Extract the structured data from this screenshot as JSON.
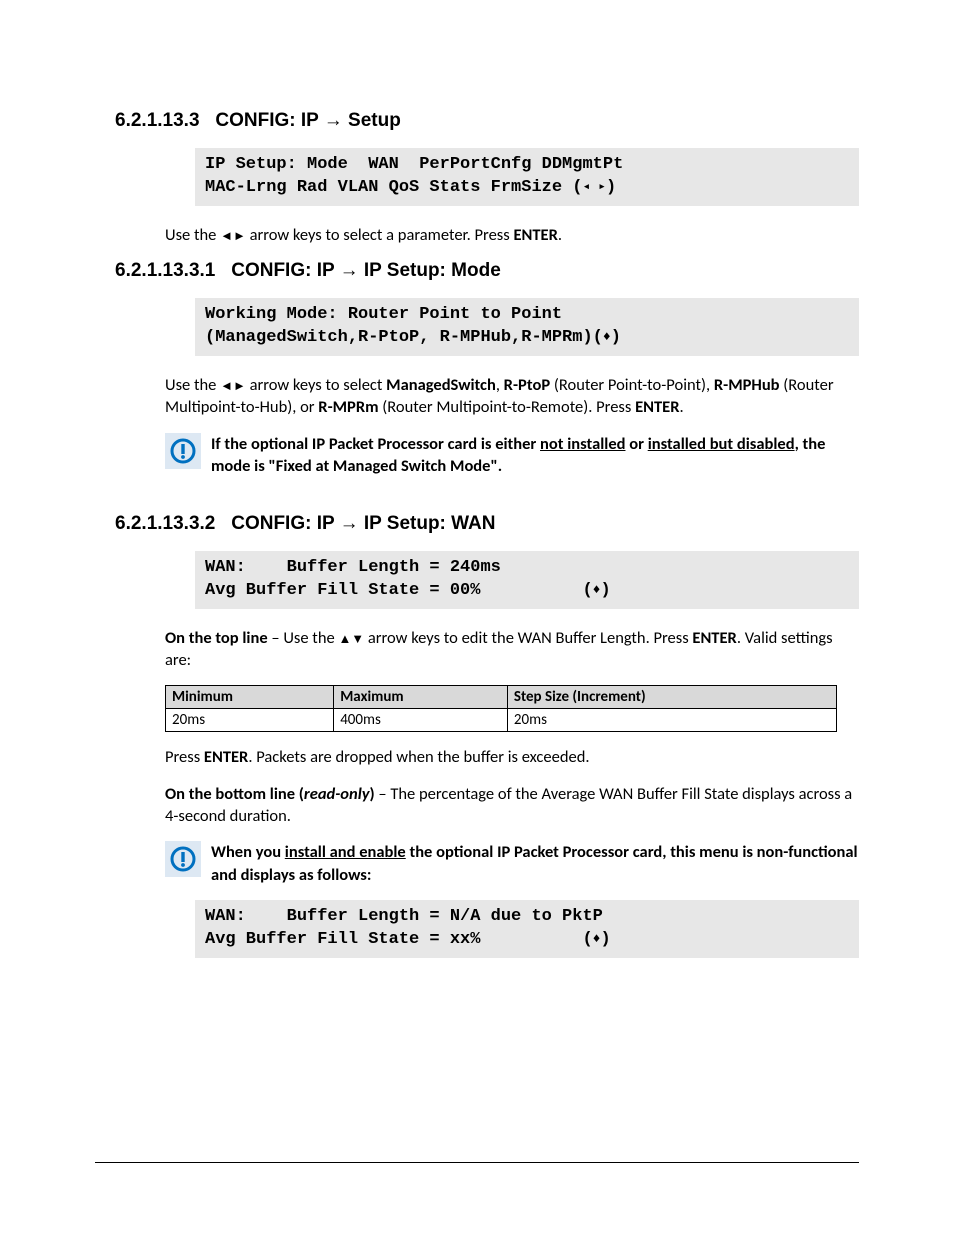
{
  "section1": {
    "heading_num": "6.2.1.13.3",
    "heading_prefix": "CONFIG: IP ",
    "heading_suffix": " Setup",
    "lcd_line1": "IP Setup: Mode  WAN  PerPortCnfg DDMgmtPt",
    "lcd_line2a": "MAC-Lrng Rad VLAN QoS Stats FrmSize (",
    "lcd_line2b": ")",
    "para_a": "Use the ",
    "para_b": " arrow keys to select a parameter. Press ",
    "para_enter": "ENTER",
    "para_c": "."
  },
  "section2": {
    "heading_num": "6.2.1.13.3.1",
    "heading_prefix": "CONFIG: IP ",
    "heading_suffix": " IP Setup: Mode",
    "lcd_line1": "Working Mode: Router Point to Point",
    "lcd_line2a": "(ManagedSwitch,R-PtoP, R-MPHub,R-MPRm)(",
    "lcd_line2b": ")",
    "para_a": "Use the ",
    "para_b": " arrow keys to select ",
    "opt1": "ManagedSwitch",
    "sep1": ", ",
    "opt2": "R-PtoP",
    "opt2_desc": " (Router Point-to-Point), ",
    "opt3": "R-MPHub",
    "opt3_desc": " (Router Multipoint-to-Hub), or ",
    "opt4": "R-MPRm",
    "opt4_desc": " (Router Multipoint-to-Remote). Press ",
    "para_enter": "ENTER",
    "para_c": ".",
    "note_a": "If the optional IP Packet Processor card is either ",
    "note_u1": "not installed",
    "note_b": " or ",
    "note_u2": "installed but disabled",
    "note_c": ", the mode is \"Fixed at Managed Switch Mode\"."
  },
  "section3": {
    "heading_num": "6.2.1.13.3.2",
    "heading_prefix": "CONFIG: IP ",
    "heading_suffix": " IP Setup: WAN",
    "lcd1_line1": "WAN:    Buffer Length = 240ms",
    "lcd1_line2a": "Avg Buffer Fill State = 00%          (",
    "lcd1_line2b": ")",
    "para1_a": "On the top line",
    "para1_b": " – Use the ",
    "para1_c": " arrow keys to edit the WAN Buffer Length. Press ",
    "para1_enter": "ENTER",
    "para1_d": ". Valid settings are:",
    "table": {
      "h1": "Minimum",
      "h2": "Maximum",
      "h3": "Step Size (Increment)",
      "c1": "20ms",
      "c2": "400ms",
      "c3": "20ms"
    },
    "para2_a": "Press ",
    "para2_enter": "ENTER",
    "para2_b": ". Packets are dropped when the buffer is exceeded.",
    "para3_a": "On the bottom line (",
    "para3_ro": "read-only",
    "para3_b": ")",
    "para3_c": " – The percentage of the Average WAN Buffer Fill State displays across a 4-second duration.",
    "note_a": "When you ",
    "note_u1": "install and enable",
    "note_b": " the optional IP Packet Processor card, this menu is non-functional and displays as follows:",
    "lcd2_line1": "WAN:    Buffer Length = N/A due to PktP",
    "lcd2_line2a": "Avg Buffer Fill State = xx%          (",
    "lcd2_line2b": ")"
  },
  "glyphs": {
    "right_arrow": "→",
    "left_tri": "◄",
    "right_tri": "►",
    "up_tri": "▲",
    "down_tri": "▼",
    "lr_small": "◂ ▸",
    "ud_small": "↕"
  }
}
